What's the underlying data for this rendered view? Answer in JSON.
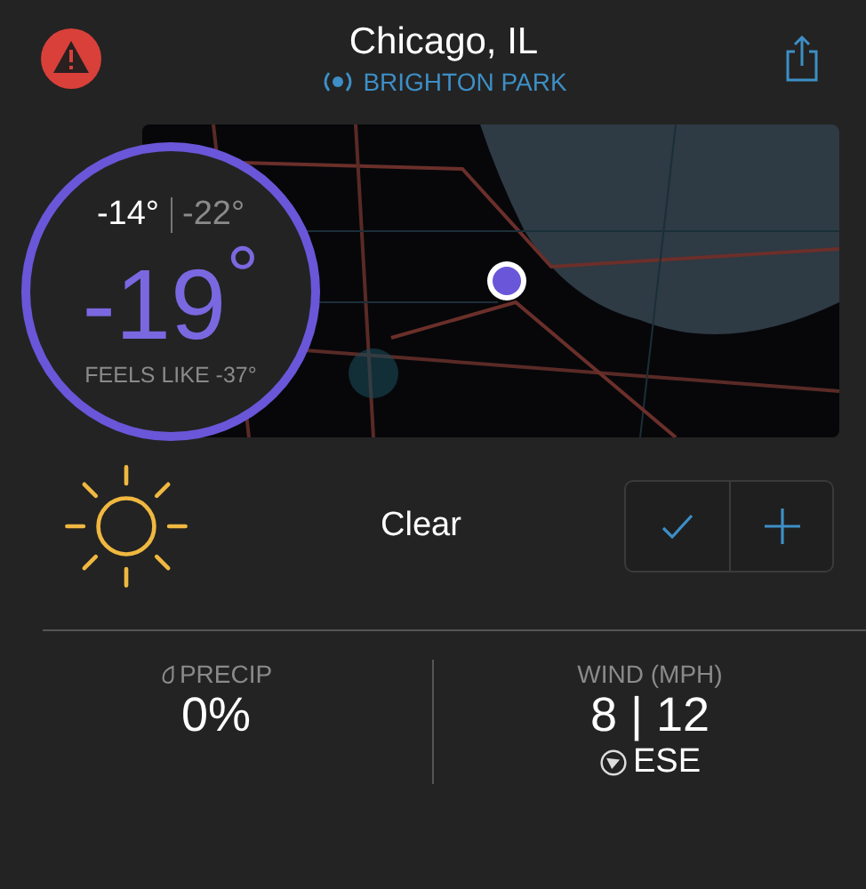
{
  "header": {
    "title": "Chicago, IL",
    "location": "BRIGHTON PARK"
  },
  "temperature": {
    "high": "-14°",
    "low": "-22°",
    "current": "-19$^{°}$",
    "feels_like": "FEELS LIKE -37°"
  },
  "condition": {
    "text": "Clear"
  },
  "stats": [
    {
      "kind": "precip",
      "label": "PRECIP",
      "value": "0%"
    },
    {
      "kind": "wind",
      "label": "WIND (MPH)",
      "value": "8 | 12",
      "direction": "ESE"
    }
  ]
}
